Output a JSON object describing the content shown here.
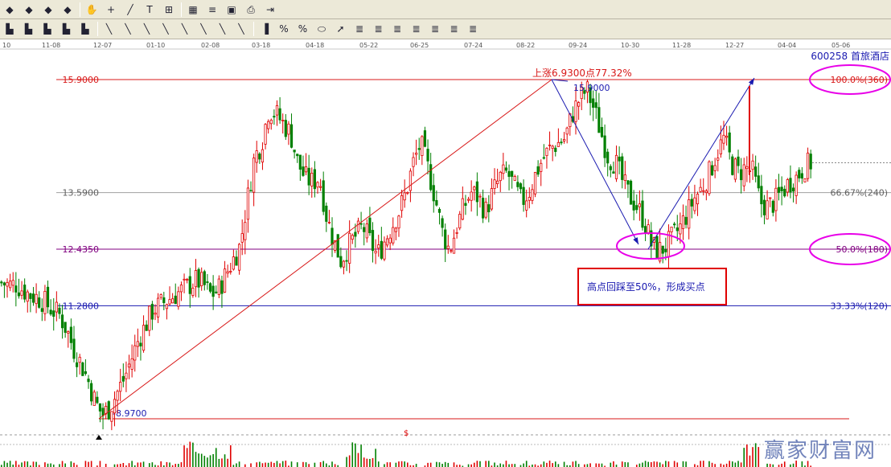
{
  "toolbar1": {
    "icons": [
      "arrow-up-icon",
      "arrow-up-icon",
      "arrow-up-icon",
      "arrow-up-icon",
      "pan-hand-icon",
      "crosshair-icon",
      "line-tool-icon",
      "text-tool-icon",
      "grid-table-icon",
      "calendar-icon",
      "notes-icon",
      "save-icon",
      "print-icon",
      "export-icon"
    ]
  },
  "toolbar2": {
    "icons": [
      "candle-type-1-icon",
      "candle-type-2-icon",
      "candle-type-3-icon",
      "candle-type-4-icon",
      "candle-type-5-icon",
      "draw-box-icon",
      "draw-fan-icon",
      "draw-rect-icon",
      "draw-hatch-icon",
      "draw-angle-icon",
      "draw-channel-icon",
      "draw-grid-icon",
      "draw-parallel-icon",
      "bar-chart-icon",
      "percent-icon",
      "percent-sign-icon",
      "ellipse-icon",
      "arrow-draw-icon",
      "fib-1-icon",
      "fib-2-icon",
      "fib-3-icon",
      "fib-4-icon",
      "fib-5-icon",
      "fib-6-icon",
      "fib-7-icon"
    ]
  },
  "stock": {
    "code_name": "600258 首旅酒店"
  },
  "annotation": {
    "text": "高点回踩至50%，形成买点"
  },
  "watermark": "赢家财富网",
  "colors": {
    "up": "#e00000",
    "down": "#008000",
    "fib_red": "#d81818",
    "fib_purple": "#800080",
    "fib_blue": "#1a1ab0",
    "magenta": "#e800e8",
    "grid_gray": "#a0a0a0"
  },
  "chart_data": {
    "type": "candlestick",
    "x_ticks": [
      "10",
      "11-08",
      "12-07",
      "01-10",
      "02-08",
      "03-18",
      "04-18",
      "05-22",
      "06-25",
      "07-24",
      "08-22",
      "09-24",
      "10-30",
      "11-28",
      "12-27",
      "04-04",
      "05-06"
    ],
    "ylim": [
      8.6,
      16.1
    ],
    "price_levels": [
      {
        "price": 15.9,
        "label": "15.9000",
        "pct_label": "100.0%(360)"
      },
      {
        "price": 13.59,
        "label": "13.5900",
        "pct_label": "66.67%(240)"
      },
      {
        "price": 12.435,
        "label": "12.4350",
        "pct_label": "50.0%(180)"
      },
      {
        "price": 11.28,
        "label": "11.2800",
        "pct_label": "33.33%(120)"
      }
    ],
    "low_point": {
      "price": 8.97,
      "label": "8.9700"
    },
    "high_point": {
      "price": 15.9,
      "label": "15.9000"
    },
    "rise_label": "上涨6.9300点77.32%",
    "volume_marker": "$",
    "trend_closes": [
      11.75,
      11.7,
      11.72,
      11.6,
      11.5,
      11.45,
      11.35,
      11.2,
      11.1,
      10.8,
      10.4,
      10.1,
      9.75,
      9.3,
      9.05,
      9.2,
      9.5,
      9.8,
      10.2,
      10.6,
      10.9,
      11.2,
      11.3,
      11.4,
      11.5,
      11.6,
      11.7,
      11.8,
      11.7,
      11.5,
      11.6,
      11.9,
      12.2,
      12.5,
      13.4,
      14.3,
      14.6,
      15.3,
      15.2,
      15.0,
      14.8,
      14.2,
      13.9,
      13.8,
      13.9,
      13.1,
      12.6,
      12.2,
      12.5,
      12.7,
      12.9,
      12.6,
      12.3,
      12.6,
      12.9,
      13.2,
      13.6,
      14.2,
      14.6,
      14.1,
      13.5,
      12.8,
      12.4,
      12.9,
      13.3,
      13.6,
      13.5,
      13.2,
      13.6,
      13.9,
      14.0,
      13.7,
      13.4,
      13.6,
      14.0,
      14.3,
      14.5,
      14.6,
      14.7,
      15.2,
      15.5,
      15.7,
      15.3,
      14.8,
      14.3,
      14.2,
      13.8,
      13.5,
      13.3,
      13.0,
      12.5,
      12.4,
      12.5,
      12.7,
      12.9,
      13.2,
      13.5,
      13.7,
      14.0,
      14.4,
      14.7,
      14.2,
      14.0,
      14.1,
      14.0,
      13.4,
      13.3,
      13.4,
      13.6,
      13.8,
      13.9,
      14.1,
      14.2
    ]
  }
}
